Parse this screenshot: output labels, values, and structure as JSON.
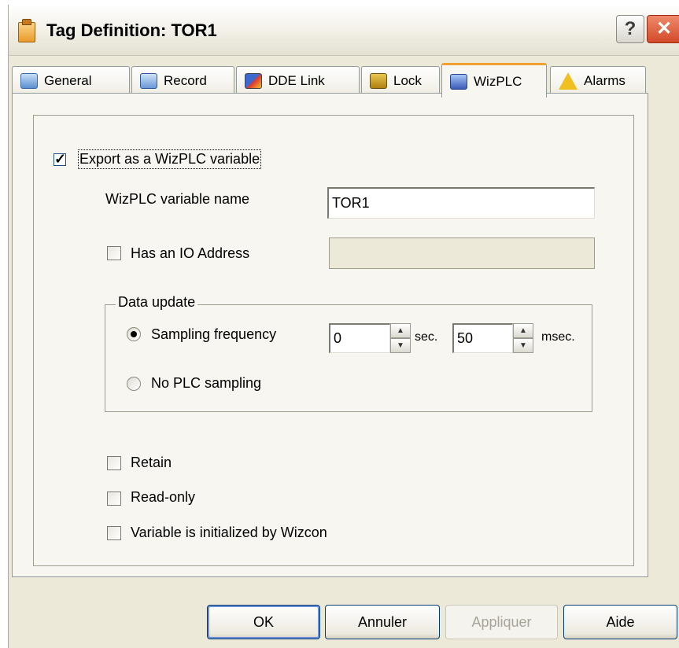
{
  "window": {
    "title": "Tag Definition: TOR1",
    "help_label": "?",
    "close_label": "✕"
  },
  "tabs": [
    {
      "label": "General",
      "icon": "general-icon"
    },
    {
      "label": "Record",
      "icon": "record-icon"
    },
    {
      "label": "DDE Link",
      "icon": "dde-link-icon"
    },
    {
      "label": "Lock",
      "icon": "lock-icon"
    },
    {
      "label": "WizPLC",
      "icon": "wizplc-icon",
      "active": true
    },
    {
      "label": "Alarms",
      "icon": "alarm-icon"
    }
  ],
  "wizplc": {
    "export_label": "Export as a WizPLC variable",
    "export_checked": true,
    "var_name_label": "WizPLC variable name",
    "var_name_value": "TOR1",
    "io_address_label": "Has an IO Address",
    "io_address_value": "",
    "data_update": {
      "legend": "Data update",
      "sampling_label": "Sampling frequency",
      "sampling_selected": true,
      "sec_value": "0",
      "sec_unit": "sec.",
      "msec_value": "50",
      "msec_unit": "msec.",
      "no_sampling_label": "No PLC sampling"
    },
    "retain_label": "Retain",
    "readonly_label": "Read-only",
    "initialized_label": "Variable is initialized by Wizcon"
  },
  "buttons": {
    "ok": "OK",
    "cancel": "Annuler",
    "apply": "Appliquer",
    "help": "Aide"
  }
}
